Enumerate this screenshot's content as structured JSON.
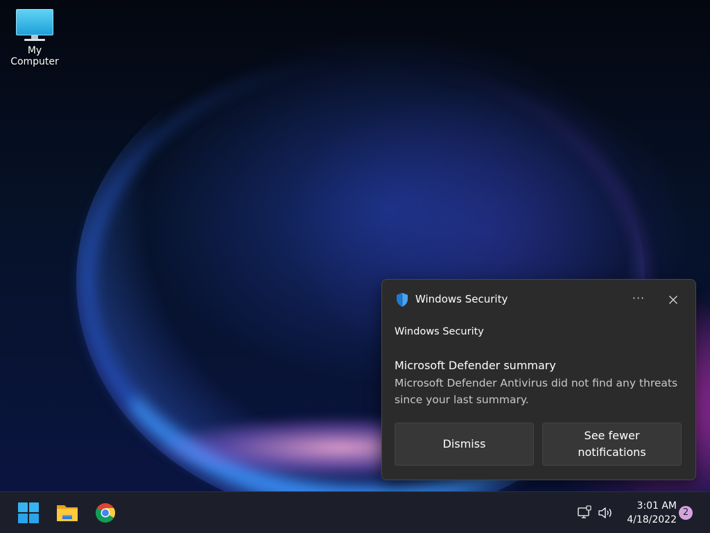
{
  "desktop": {
    "icons": [
      {
        "label": "My Computer",
        "icon": "monitor-icon"
      }
    ]
  },
  "toast": {
    "app_name": "Windows Security",
    "app_icon": "shield-icon",
    "more_options_icon": "ellipsis-icon",
    "more_options_glyph": "···",
    "close_icon": "close-icon",
    "attribution": "Windows Security",
    "title": "Microsoft Defender summary",
    "body": "Microsoft Defender Antivirus did not find any threats since your last summary.",
    "buttons": [
      {
        "label": "Dismiss"
      },
      {
        "label": "See fewer notifications"
      }
    ],
    "accent_color": "#1f78d1"
  },
  "taskbar": {
    "apps": [
      {
        "name": "start-button",
        "icon": "windows-logo-icon"
      },
      {
        "name": "file-explorer-button",
        "icon": "folder-icon"
      },
      {
        "name": "chrome-button",
        "icon": "chrome-icon"
      }
    ],
    "tray": {
      "network_icon": "network-icon",
      "volume_icon": "volume-icon",
      "time": "3:01 AM",
      "date": "4/18/2022",
      "notification_count": "2"
    },
    "badge_color": "#d6a3e0"
  }
}
